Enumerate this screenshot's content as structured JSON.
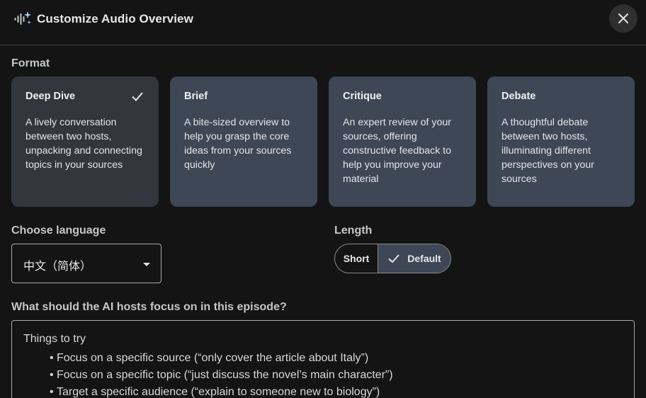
{
  "dialog": {
    "title": "Customize Audio Overview",
    "logo_icon": "audio-sparkle-icon",
    "close_icon": "close-icon"
  },
  "format": {
    "label": "Format",
    "options": [
      {
        "title": "Deep Dive",
        "description": "A lively conversation between two hosts, unpacking and connecting topics in your sources",
        "selected": true
      },
      {
        "title": "Brief",
        "description": "A bite-sized overview to help you grasp the core ideas from your sources quickly",
        "selected": false
      },
      {
        "title": "Critique",
        "description": "An expert review of your sources, offering constructive feedback to help you improve your material",
        "selected": false
      },
      {
        "title": "Debate",
        "description": "A thoughtful debate between two hosts, illuminating different perspectives on your sources",
        "selected": false
      }
    ]
  },
  "language": {
    "label": "Choose language",
    "selected": "中文（简体）"
  },
  "length": {
    "label": "Length",
    "options": [
      {
        "label": "Short",
        "selected": false
      },
      {
        "label": "Default",
        "selected": true
      }
    ]
  },
  "focus": {
    "label": "What should the AI hosts focus on in this episode?",
    "placeholder_heading": "Things to try",
    "placeholder_items": [
      "Focus on a specific source (“only cover the article about Italy”)",
      "Focus on a specific topic (“just discuss the novel’s main character”)",
      "Target a specific audience (“explain to someone new to biology”)"
    ]
  },
  "colors": {
    "background": "#141414",
    "card": "#3d4756",
    "card_selected": "#34363d",
    "logo_accent": "#a8c7fa"
  }
}
